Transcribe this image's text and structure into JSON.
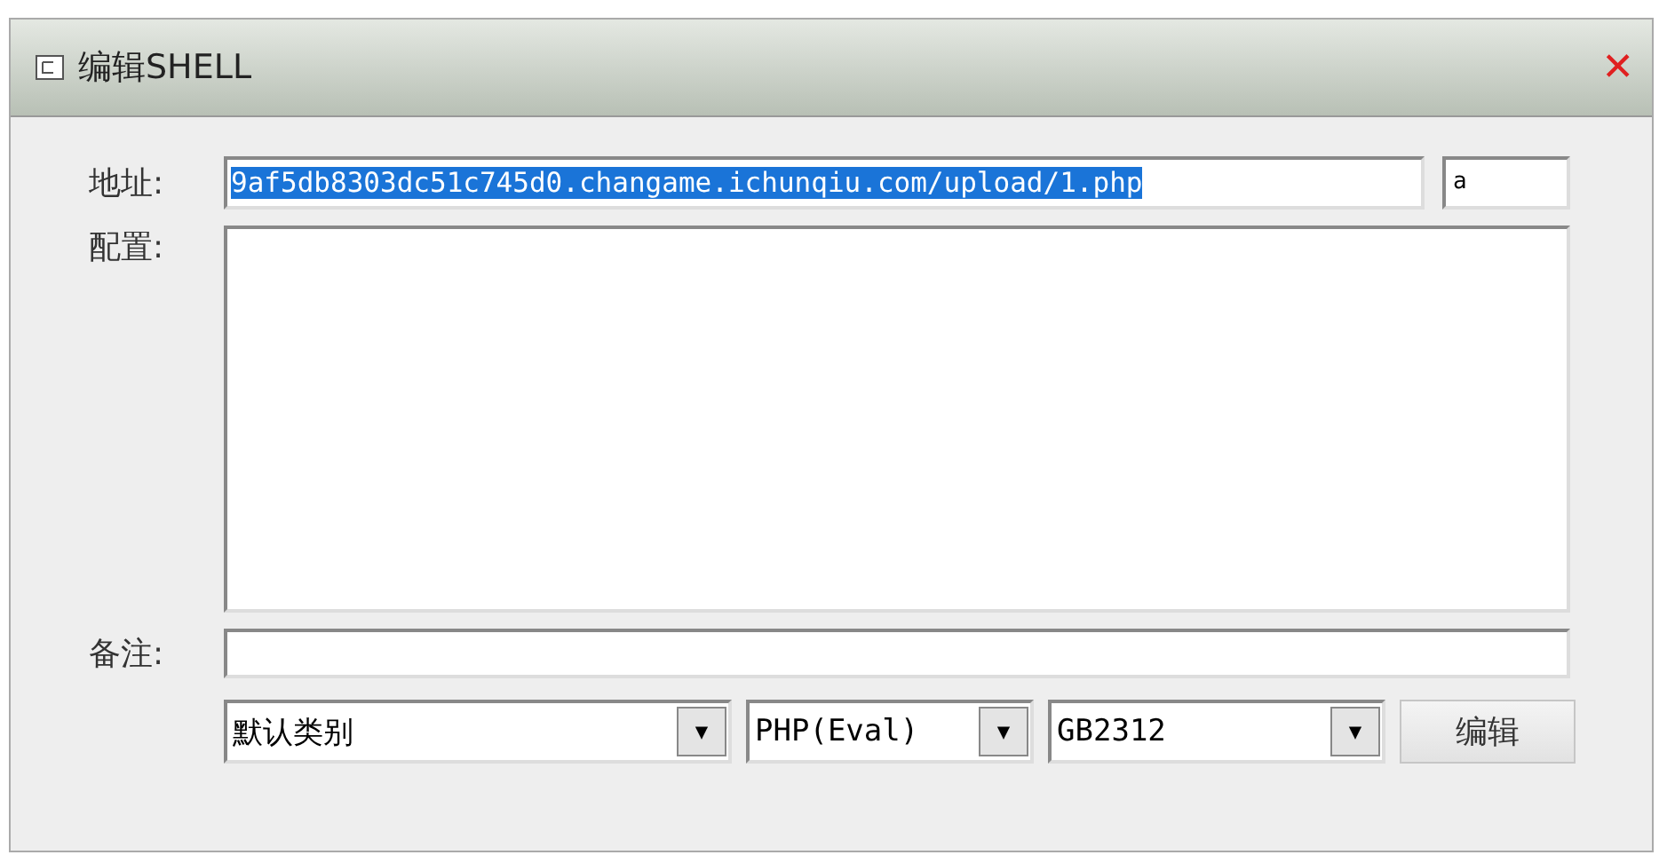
{
  "window": {
    "title": "编辑SHELL",
    "close": "✕"
  },
  "address": {
    "label": "地址:",
    "value": "9af5db8303dc51c745d0.changame.ichunqiu.com/upload/1.php",
    "selected": true,
    "password": "a"
  },
  "config": {
    "label": "配置:"
  },
  "note": {
    "label": "备注:"
  },
  "dropdowns": [
    {
      "value": "默认类别",
      "arrow": "▼"
    },
    {
      "value": "PHP(Eval)",
      "arrow": "▼"
    },
    {
      "value": "GB2312",
      "arrow": "▼"
    }
  ],
  "buttons": [
    "编辑"
  ]
}
